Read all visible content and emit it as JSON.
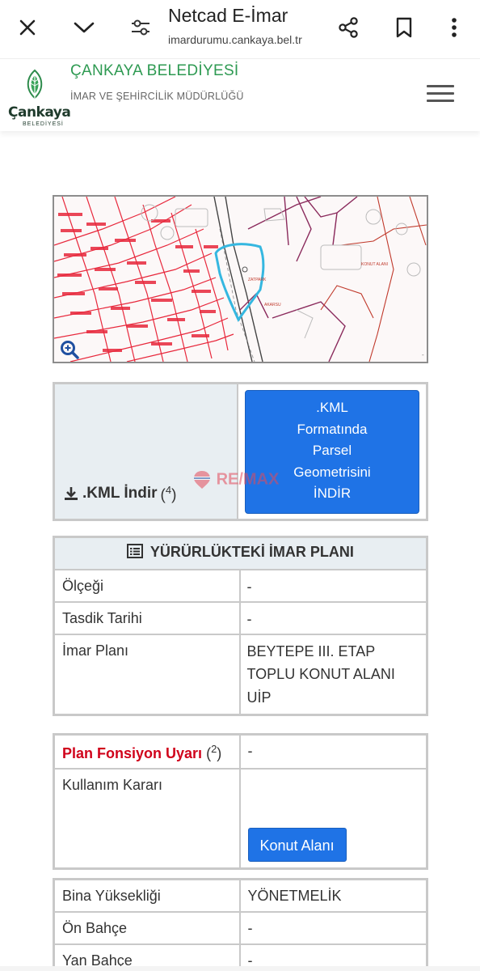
{
  "browser": {
    "title": "Netcad E-İmar",
    "url": "imardurumu.cankaya.bel.tr",
    "icons": [
      "close-icon",
      "chevron-down-icon",
      "site-settings-icon",
      "share-icon",
      "bookmark-icon",
      "more-vert-icon"
    ]
  },
  "header": {
    "logo_word": "Çankaya",
    "logo_sub": "BELEDİYESİ",
    "title": "ÇANKAYA BELEDİYESİ",
    "subtitle": "İMAR VE ŞEHİRCİLİK MÜDÜRLÜĞÜ"
  },
  "map": {
    "labels": [
      "ZATPARK",
      "KONUT ALANI",
      "AKARSU"
    ]
  },
  "kml": {
    "label": ".KML İndir",
    "footnote": "4",
    "button": [
      ".KML",
      "Formatında",
      "Parsel",
      "Geometrisini",
      "İNDİR"
    ]
  },
  "watermark": "RE/MAX",
  "plan": {
    "title": "YÜRÜRLÜKTEKİ İMAR PLANI",
    "rows": [
      {
        "key": "Ölçeği",
        "value": "-"
      },
      {
        "key": "Tasdik Tarihi",
        "value": "-"
      },
      {
        "key": "İmar Planı",
        "value": "BEYTEPE III. ETAP TOPLU KONUT ALANI UİP"
      }
    ]
  },
  "fonksiyon": {
    "warning_label": "Plan Fonsiyon Uyarı",
    "warning_footnote": "2",
    "warning_value": "-",
    "usage_label": "Kullanım Kararı",
    "usage_button": "Konut Alanı"
  },
  "bina": {
    "rows": [
      {
        "key": "Bina Yüksekliği",
        "value": "YÖNETMELİK"
      },
      {
        "key": "Ön Bahçe",
        "value": "-"
      },
      {
        "key": "Yan Bahçe",
        "value": "-"
      }
    ]
  },
  "colors": {
    "accent": "#1f73e6",
    "brand_green": "#2e9a52",
    "warning": "#d0021b",
    "map_red": "#e8283c"
  }
}
